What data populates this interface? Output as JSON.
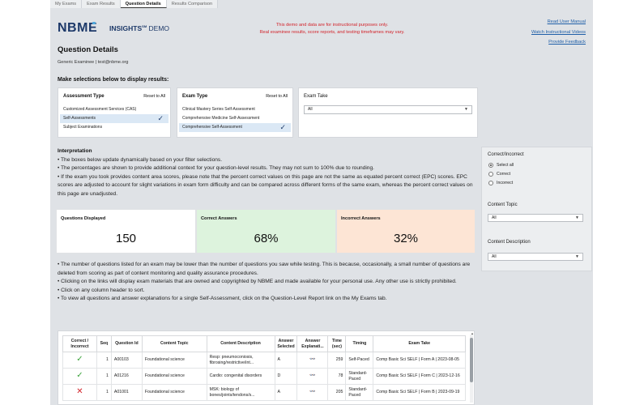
{
  "tabs": [
    {
      "label": "My Exams"
    },
    {
      "label": "Exam Results"
    },
    {
      "label": "Question Details"
    },
    {
      "label": "Results Comparison"
    }
  ],
  "header": {
    "logo": "NBME",
    "insights": "INSIGHTS",
    "insights_sup": "SM",
    "demo": "DEMO",
    "disclaimer_line1": "This demo and data are for instructional purposes only.",
    "disclaimer_line2": "Real examinee results, score reports, and testing timeframes may vary.",
    "links": [
      "Read User Manual",
      "Watch Instructional Videos",
      "Provide Feedback"
    ],
    "disclaimer_color": "#d2232a"
  },
  "page": {
    "title": "Question Details",
    "examinee": "Generic Examinee | test@nbme.org",
    "make_selections": "Make selections below to display results:"
  },
  "filters": {
    "assessment_type": {
      "title": "Assessment Type",
      "reset": "Reset to All",
      "options": [
        "Customized Assessment Services (CAS)",
        "Self-Assessments",
        "Subject Examinations"
      ],
      "selected_index": 1
    },
    "exam_type": {
      "title": "Exam Type",
      "reset": "Reset to All",
      "options": [
        "Clinical Mastery Series Self-Assessment",
        "Comprehensive Medicine Self-Assessment",
        "Comprehensive Self-Assessment"
      ],
      "selected_index": 2
    },
    "exam_take": {
      "title": "Exam Take",
      "value": "All"
    }
  },
  "interpretation": {
    "title": "Interpretation",
    "lines": [
      "• The boxes below update dynamically based on your filter selections.",
      "• The percentages are shown to provide additional context for your question-level results. They may not sum to 100% due to rounding.",
      "• If the exam you took provides content area scores, please note that the percent correct values on this page are not the same as equated percent correct (EPC) scores. EPC scores are adjusted to account for slight variations in exam form difficulty and can be compared across different forms of the same exam, whereas the percent correct values on this page are unadjusted."
    ]
  },
  "stats": {
    "questions_label": "Questions Displayed",
    "questions_value": "150",
    "correct_label": "Correct Answers",
    "correct_value": "68%",
    "incorrect_label": "Incorrect Answers",
    "incorrect_value": "32%",
    "correct_bg": "#ddf3dd",
    "incorrect_bg": "#fde5d5"
  },
  "notes": [
    "• The number of questions listed for an exam may be lower than the number of questions you saw while testing. This is because, occasionally, a small number of questions are deleted from scoring as part of content monitoring and quality assurance procedures.",
    "• Clicking on the links will display exam materials that are owned and copyrighted by NBME and made available for your personal use. Any other use is strictly prohibited.",
    "• Click on any column header to sort.",
    "• To view all questions and answer explanations for a single Self-Assessment, click on the Question-Level Report link on the My Exams tab."
  ],
  "right_panel": {
    "ci_title": "Correct/Incorrect",
    "ci_options": [
      "Select all",
      "Correct",
      "Incorrect"
    ],
    "ci_selected": 0,
    "topic_title": "Content Topic",
    "topic_value": "All",
    "desc_title": "Content Description",
    "desc_value": "All"
  },
  "table": {
    "headers": [
      "Correct / Incorrect",
      "Seq",
      "Question Id",
      "Content Topic",
      "Content Description",
      "Answer Selected",
      "Answer Explanati...",
      "Time (sec)",
      "Timing",
      "Exam Take"
    ],
    "rows": [
      {
        "correct": true,
        "seq": "1",
        "qid": "A00103",
        "topic": "Foundational science",
        "desc": "Resp: pneumoconiosis, fibrosing/restrictive/int...",
        "answer": "A",
        "time": "259",
        "timing": "Self-Paced",
        "take": "Comp Basic Sci SELF | Form A | 2023-08-05"
      },
      {
        "correct": true,
        "seq": "1",
        "qid": "A01216",
        "topic": "Foundational science",
        "desc": "Cardio: congenital disorders",
        "answer": "D",
        "time": "78",
        "timing": "Standard-Paced",
        "take": "Comp Basic Sci SELF | Form C | 2023-12-16"
      },
      {
        "correct": false,
        "seq": "1",
        "qid": "A01001",
        "topic": "Foundational science",
        "desc": "MSK: biology of bones/joints/tendons/s...",
        "answer": "A",
        "time": "205",
        "timing": "Standard-Paced",
        "take": "Comp Basic Sci SELF | Form B | 2023-09-19"
      }
    ]
  }
}
